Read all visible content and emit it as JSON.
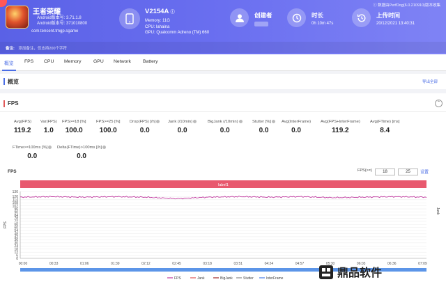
{
  "header": {
    "game": {
      "name": "王者荣耀",
      "android_version": "Android版本号: 3.71.1.8",
      "android_code": "Android版本号: 371010800",
      "package": "com.tencent.tmgp.sgame"
    },
    "device": {
      "name": "V2154A",
      "memory": "Memory: 11G",
      "cpu": "CPU: lahaina",
      "gpu": "GPU: Qualcomm Adreno (TM) 660"
    },
    "creator_label": "创建者",
    "duration_label": "时长",
    "duration_value": "0h 10m 47s",
    "upload_label": "上传时间",
    "upload_value": "20/12/2021 13:40:31",
    "data_source": "数据由PerfDog(6.0.210910)版本收集",
    "note_key": "备注:",
    "note_placeholder": "添加备注，仅支持200个字符"
  },
  "tabs": [
    "概览",
    "FPS",
    "CPU",
    "Memory",
    "GPU",
    "Network",
    "Battery"
  ],
  "overview": {
    "title": "概览",
    "export_label": "导出全部"
  },
  "fps_section": {
    "title": "FPS",
    "collapse_icon": "chevron-up-icon",
    "stats_row1": [
      {
        "label": "Avg(FPS)",
        "value": "119.2"
      },
      {
        "label": "Var(FPS)",
        "value": "1.0"
      },
      {
        "label": "FPS>=18 [%]",
        "value": "100.0"
      },
      {
        "label": "FPS>=25 [%]",
        "value": "100.0"
      },
      {
        "label": "Drop(FPS) [/h]",
        "value": "0.0"
      },
      {
        "label": "Jank (/10min)",
        "value": "0.0"
      },
      {
        "label": "BigJank (/10min)",
        "value": "0.0"
      },
      {
        "label": "Stutter [%]",
        "value": "0.0"
      },
      {
        "label": "Avg(InterFrame)",
        "value": "0.0"
      },
      {
        "label": "Avg(FPS+InterFrame)",
        "value": "119.2"
      },
      {
        "label": "Avg(FTime) [ms]",
        "value": "8.4"
      }
    ],
    "stats_row2": [
      {
        "label": "FTime>=100ms [%]",
        "value": "0.0"
      },
      {
        "label": "Delta(FTime)>100ms [/h]",
        "value": "0.0"
      }
    ],
    "chart_label": "FPS",
    "threshold_label": "FPS(>=)",
    "threshold_values": [
      "18",
      "25"
    ],
    "threshold_set": "设置"
  },
  "chart_data": {
    "type": "line",
    "banner": "label1",
    "ylabel": "FPS",
    "y2label": "Jank",
    "ylim": [
      0,
      130
    ],
    "yticks": [
      0,
      6,
      12,
      18,
      24,
      30,
      36,
      42,
      48,
      54,
      60,
      66,
      72,
      78,
      84,
      90,
      96,
      102,
      108,
      114,
      120,
      130
    ],
    "x": [
      "00:00",
      "00:33",
      "01:06",
      "01:39",
      "02:12",
      "02:45",
      "03:18",
      "03:51",
      "04:24",
      "04:57",
      "05:30",
      "06:03",
      "06:36",
      "07:09"
    ],
    "series": [
      {
        "name": "FPS",
        "color": "#c0389e",
        "values": [
          119,
          120,
          119,
          120,
          119,
          116,
          119,
          120,
          119,
          120,
          118,
          119,
          120,
          119
        ]
      },
      {
        "name": "Jank",
        "color": "#e05858",
        "values": []
      },
      {
        "name": "BigJank",
        "color": "#a02828",
        "values": []
      },
      {
        "name": "Stutter",
        "color": "#8a8a8a",
        "values": []
      },
      {
        "name": "InterFrame",
        "color": "#4a7de5",
        "values": []
      }
    ],
    "grid": true,
    "legend": "bottom"
  },
  "watermark": {
    "text": "鼎品软件"
  }
}
